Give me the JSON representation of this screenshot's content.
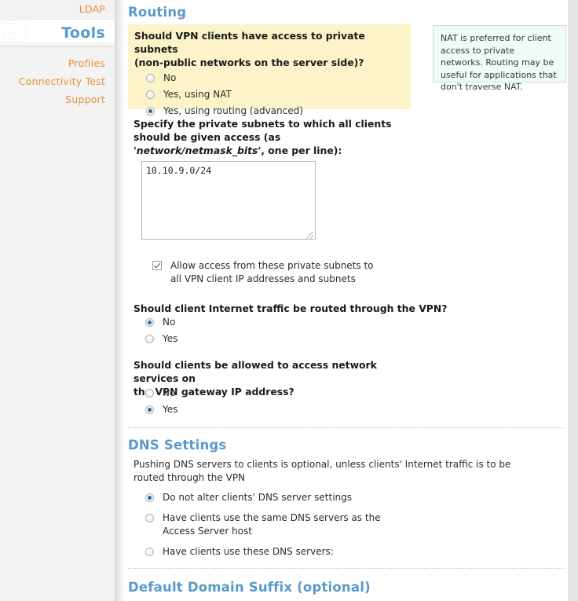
{
  "sidebar": {
    "top_link": "LDAP",
    "section_header": "Tools",
    "items": [
      {
        "label": "Profiles"
      },
      {
        "label": "Connectivity Test"
      },
      {
        "label": "Support"
      }
    ]
  },
  "main": {
    "routing": {
      "heading": "Routing",
      "subnet_access": {
        "question_line1": "Should VPN clients have access to private subnets",
        "question_line2": "(non-public networks on the server side)?",
        "options": [
          {
            "label": "No",
            "selected": false
          },
          {
            "label": "Yes, using NAT",
            "selected": false
          },
          {
            "label": "Yes, using routing (advanced)",
            "selected": true
          }
        ]
      },
      "note": {
        "text": "NAT is preferred for client access to private networks. Routing may be useful for applications that don't traverse NAT."
      },
      "subnets": {
        "label_part1": "Specify the private subnets to which all clients should be given access (as '",
        "label_italic": "network/netmask_bits",
        "label_part2": "', one per line):",
        "value": "10.10.9.0/24",
        "placeholder": ""
      },
      "allow_access": {
        "checked": true,
        "label_line1": "Allow access from these private subnets to",
        "label_line2": "all VPN client IP addresses and subnets"
      },
      "internet_traffic": {
        "question": "Should client Internet traffic be routed through the VPN?",
        "options": [
          {
            "label": "No",
            "selected": true
          },
          {
            "label": "Yes",
            "selected": false
          }
        ]
      },
      "gateway_services": {
        "question_line1": "Should clients be allowed to access network services on",
        "question_line2": "the VPN gateway IP address?",
        "options": [
          {
            "label": "No",
            "selected": false
          },
          {
            "label": "Yes",
            "selected": true
          }
        ]
      }
    },
    "dns": {
      "heading": "DNS Settings",
      "description": "Pushing DNS servers to clients is optional, unless clients' Internet traffic is to be routed through the VPN",
      "options": [
        {
          "label_line1": "Do not alter clients' DNS server settings",
          "label_line2": "",
          "selected": true
        },
        {
          "label_line1": "Have clients use the same DNS servers as the",
          "label_line2": "Access Server host",
          "selected": false
        },
        {
          "label_line1": "Have clients use these DNS servers:",
          "label_line2": "",
          "selected": false
        }
      ]
    },
    "domain_suffix": {
      "heading": "Default Domain Suffix (optional)"
    }
  },
  "colors": {
    "accent_blue": "#5b9ac9",
    "link_orange": "#e8903a",
    "highlight_yellow": "#fcf3c8",
    "note_green_bg": "#f1fbf5",
    "radio_dot": "#1f6fad"
  }
}
